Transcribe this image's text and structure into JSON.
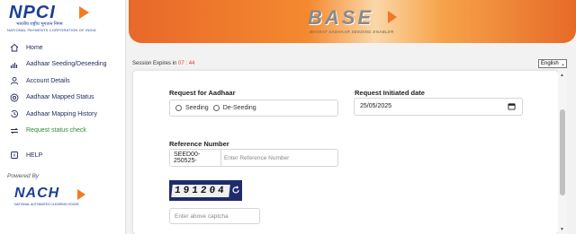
{
  "brand": {
    "npci": "NPCI",
    "npci_hindi": "भारतीय राष्ट्रीय भुगतान निगम",
    "npci_sub": "NATIONAL PAYMENTS CORPORATION OF INDIA",
    "powered_by": "Powered By",
    "nach": "NACH",
    "nach_sub": "NATIONAL AUTOMATED CLEARING HOUSE",
    "accent": "#f47b20",
    "navy": "#1c3f95"
  },
  "sidebar": {
    "items": [
      {
        "label": "Home",
        "icon": "home-icon"
      },
      {
        "label": "Aadhaar Seeding/Deseeding",
        "icon": "chart-icon"
      },
      {
        "label": "Account Details",
        "icon": "user-icon"
      },
      {
        "label": "Aadhaar Mapped Status",
        "icon": "target-icon"
      },
      {
        "label": "Aadhaar Mapping History",
        "icon": "history-icon"
      },
      {
        "label": "Request status check",
        "icon": "swap-icon",
        "active": true
      },
      {
        "label": "HELP",
        "icon": "help-icon"
      }
    ]
  },
  "banner": {
    "title": "BASE",
    "subtitle": "BHARAT AADHAAR SEEDING ENABLER"
  },
  "session": {
    "prefix": "Session Expires in",
    "time": "07 : 44"
  },
  "language": {
    "selected": "English"
  },
  "form": {
    "request_for_label": "Request for Aadhaar",
    "option_seeding": "Seeding",
    "option_deseeding": "De-Seeding",
    "date_label": "Request Initiated date",
    "date_value": "25/05/2025",
    "ref_label": "Reference Number",
    "ref_prefix": "SEED00-250525-",
    "ref_placeholder": "Enter Reference Number",
    "captcha_text": "191204",
    "captcha_placeholder": "Enter above captcha"
  }
}
